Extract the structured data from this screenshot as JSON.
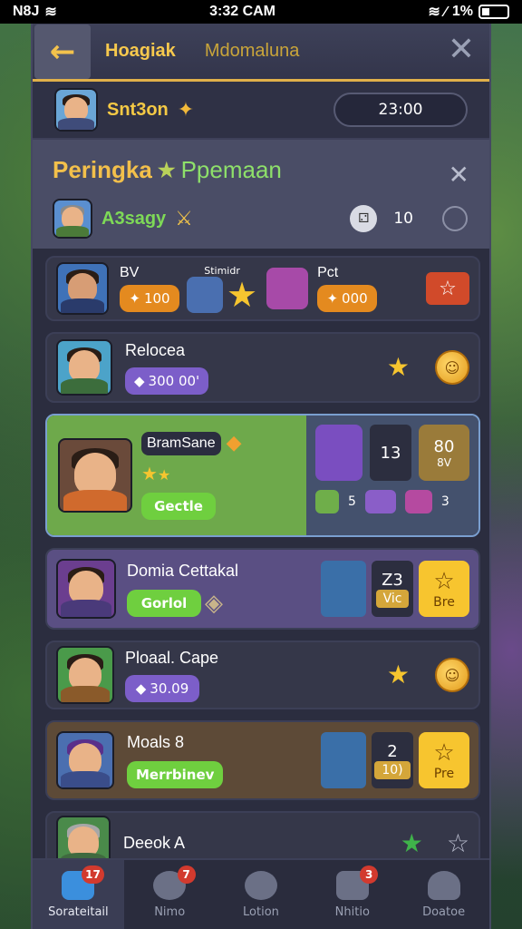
{
  "status_bar": {
    "carrier": "N8J",
    "time": "3:32 CAM",
    "battery": "1%"
  },
  "header": {
    "back_icon": "back-arrow-icon",
    "tab_active": "Hoagiak",
    "tab_inactive": "Mdomaluna",
    "close_icon": "close-icon"
  },
  "player": {
    "name": "Snt3on",
    "score": "23:00"
  },
  "ranking": {
    "title_part1": "Peringka",
    "title_part2": "Ppemaan",
    "sub_name": "A3sagy",
    "dice_value": "10"
  },
  "rows": [
    {
      "left_name": "BV",
      "left_value": "100",
      "middle_label": "Stimidr",
      "right_name": "Pct",
      "right_value": "000"
    },
    {
      "name": "Relocea",
      "value": "300 00'"
    },
    {
      "name": "BramSane",
      "button": "Gectle",
      "right_num": "13",
      "right_tile": "80",
      "right_tile_sub": "8V",
      "mini_a": "5",
      "mini_b": "3"
    },
    {
      "name": "Domia Cettakal",
      "button": "Gorlol",
      "num_top": "Z3",
      "num_bottom": "Vic",
      "tile_label": "Bre"
    },
    {
      "name": "Ploaal. Cape",
      "value": "30.09"
    },
    {
      "name": "Moals 8",
      "button": "Merrbinev",
      "num_top": "2",
      "num_bottom": "10)",
      "tile_label": "Pre"
    },
    {
      "name": "Deeok A"
    }
  ],
  "nav": [
    {
      "label": "Sorateitail",
      "badge": "17",
      "icon": "home-icon"
    },
    {
      "label": "Nimo",
      "badge": "7",
      "icon": "clock-icon"
    },
    {
      "label": "Lotion",
      "badge": "",
      "icon": "speed-icon"
    },
    {
      "label": "Nhitio",
      "badge": "3",
      "icon": "dice-icon"
    },
    {
      "label": "Doatoe",
      "badge": "",
      "icon": "profile-icon"
    }
  ]
}
